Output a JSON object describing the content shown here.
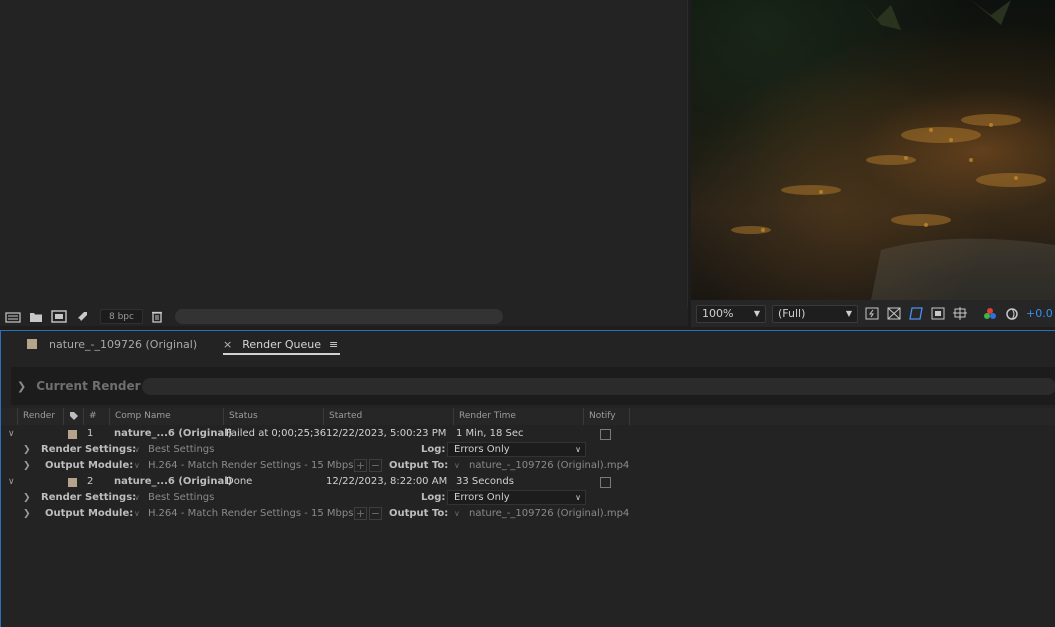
{
  "project_toolbar": {
    "bpc_label": "8 bpc",
    "icons": [
      "interpret-footage-icon",
      "folder-icon",
      "composition-icon",
      "render-rocket-icon",
      "trash-icon"
    ]
  },
  "viewer": {
    "zoom": "100%",
    "resolution": "(Full)",
    "exposure": "+0.0"
  },
  "render_queue": {
    "comp_tab_label": "nature_-_109726 (Original)",
    "rq_tab_label": "Render Queue",
    "current_render_label": "Current Render",
    "columns": [
      "Render",
      "#",
      "Comp Name",
      "Status",
      "Started",
      "Render Time",
      "Notify"
    ],
    "items": [
      {
        "index": "1",
        "comp_name": "nature_...6 (Original)",
        "status": "Failed at 0;00;25;36",
        "started": "12/22/2023, 5:00:23 PM",
        "render_time": "1 Min, 18 Sec",
        "render_settings_label": "Render Settings:",
        "render_settings_value": "Best Settings",
        "log_label": "Log:",
        "log_value": "Errors Only",
        "output_module_label": "Output Module:",
        "output_module_value": "H.264 - Match Render Settings - 15 Mbps",
        "output_to_label": "Output To:",
        "output_to_value": "nature_-_109726 (Original).mp4"
      },
      {
        "index": "2",
        "comp_name": "nature_...6 (Original)",
        "status": "Done",
        "started": "12/22/2023, 8:22:00 AM",
        "render_time": "33 Seconds",
        "render_settings_label": "Render Settings:",
        "render_settings_value": "Best Settings",
        "log_label": "Log:",
        "log_value": "Errors Only",
        "output_module_label": "Output Module:",
        "output_module_value": "H.264 - Match Render Settings - 15 Mbps",
        "output_to_label": "Output To:",
        "output_to_value": "nature_-_109726 (Original).mp4"
      }
    ]
  }
}
